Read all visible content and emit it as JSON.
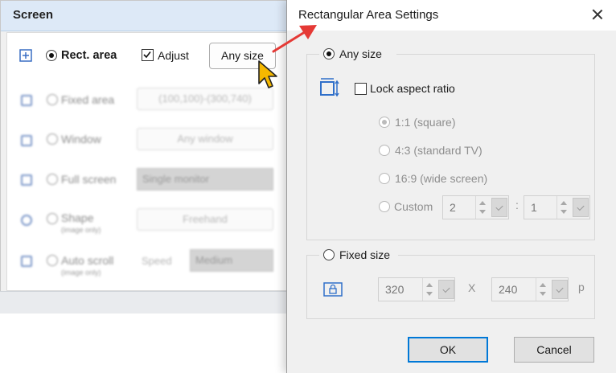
{
  "screen_panel": {
    "title": "Screen",
    "rect_area": {
      "label": "Rect. area",
      "selected": true
    },
    "adjust": {
      "label": "Adjust",
      "checked": true
    },
    "any_size_button": "Any size",
    "rows": [
      {
        "label": "Fixed area",
        "control": "(100,100)-(300,740)"
      },
      {
        "label": "Window",
        "control": "Any window"
      },
      {
        "label": "Full screen",
        "control": "Single monitor"
      },
      {
        "label": "Shape",
        "note": "(image only)",
        "control": "Freehand"
      },
      {
        "label": "Auto scroll",
        "note": "(image only)",
        "speed_label": "Speed",
        "control": "Medium"
      }
    ]
  },
  "dialog": {
    "title": "Rectangular Area Settings",
    "any_size": {
      "label": "Any size",
      "selected": true
    },
    "lock_aspect": {
      "label": "Lock aspect ratio",
      "checked": false
    },
    "ratios": [
      {
        "label": "1:1 (square)",
        "selected": true
      },
      {
        "label": "4:3 (standard TV)",
        "selected": false
      },
      {
        "label": "16:9 (wide screen)",
        "selected": false
      },
      {
        "label": "Custom",
        "selected": false
      }
    ],
    "custom": {
      "width": "2",
      "separator": ":",
      "height": "1"
    },
    "fixed_size": {
      "label": "Fixed size",
      "selected": false,
      "width": "320",
      "separator": "X",
      "height": "240",
      "unit": "p"
    },
    "ok_label": "OK",
    "cancel_label": "Cancel"
  },
  "colors": {
    "accent": "#0078d7",
    "arrow": "#e53935",
    "cursor": "#f5b800",
    "header": "#dde9f7"
  },
  "icons": [
    "rect-area-icon",
    "fixed-area-icon",
    "window-icon",
    "full-screen-icon",
    "shape-icon",
    "auto-scroll-icon",
    "resize-icon",
    "lock-icon",
    "close-icon",
    "pointer-cursor-icon",
    "red-arrow-icon"
  ]
}
